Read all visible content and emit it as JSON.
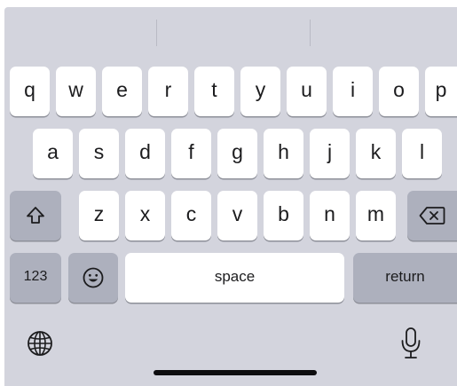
{
  "keyboard": {
    "row1": [
      "q",
      "w",
      "e",
      "r",
      "t",
      "y",
      "u",
      "i",
      "o",
      "p"
    ],
    "row2": [
      "a",
      "s",
      "d",
      "f",
      "g",
      "h",
      "j",
      "k",
      "l"
    ],
    "row3": [
      "z",
      "x",
      "c",
      "v",
      "b",
      "n",
      "m"
    ],
    "numbers_label": "123",
    "space_label": "space",
    "return_label": "return",
    "icons": {
      "shift": "shift-icon",
      "backspace": "backspace-icon",
      "emoji": "emoji-icon",
      "globe": "globe-icon",
      "mic": "microphone-icon"
    }
  },
  "colors": {
    "keyboard_bg": "#d3d4dd",
    "letter_key": "#ffffff",
    "function_key": "#adb0bd"
  }
}
